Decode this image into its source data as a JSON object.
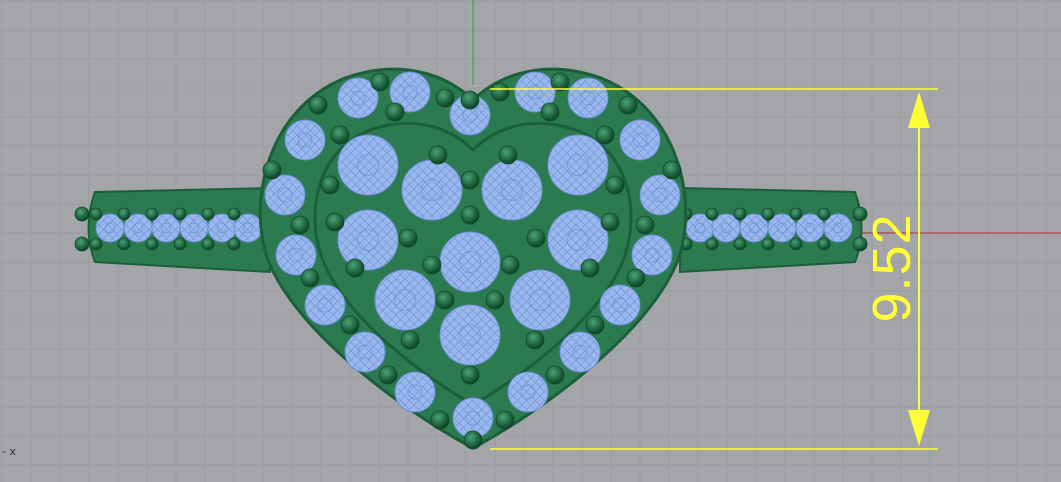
{
  "viewport": {
    "dimension_value": "9.52",
    "axis_label": "- x",
    "colors": {
      "background": "#a3a5a8",
      "grid": "#9a9c9f",
      "major_grid": "#8f9194",
      "metal": "#2c7a4f",
      "metal_dark": "#1b5e3a",
      "gem": "#9ab8ee",
      "dimension": "#ffff33",
      "x_axis": "#b03030",
      "y_axis": "#2e9a48"
    },
    "objects": [
      "ring-band",
      "heart-head",
      "pave-gems",
      "prongs",
      "dimension-line"
    ]
  }
}
